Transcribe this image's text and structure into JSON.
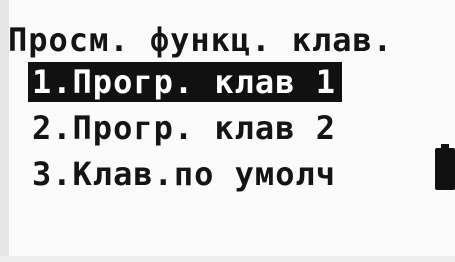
{
  "screen": {
    "title": "Просм. функц. клав."
  },
  "menu": {
    "selected_index": 0,
    "items": [
      {
        "label": "1.Прогр. клав 1"
      },
      {
        "label": "2.Прогр. клав 2"
      },
      {
        "label": "3.Клав.по умолч"
      }
    ]
  },
  "status": {
    "battery_icon": "battery-icon",
    "battery_level": 1.0
  },
  "colors": {
    "lcd_background": "#fbfbfb",
    "text": "#141414",
    "highlight_background": "#111111",
    "highlight_text": "#ffffff"
  }
}
